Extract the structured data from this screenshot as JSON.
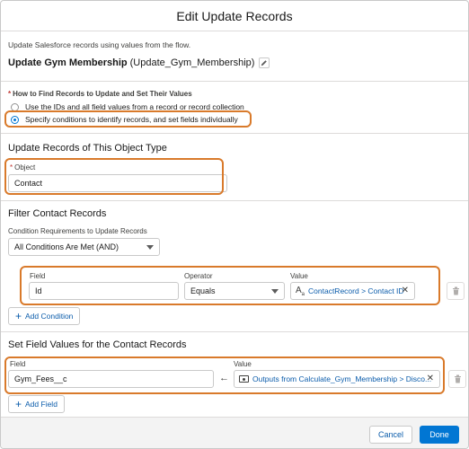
{
  "header": {
    "title": "Edit Update Records"
  },
  "intro": "Update Salesforce records using values from the flow.",
  "element": {
    "label": "Update Gym Membership",
    "api_name": "(Update_Gym_Membership)"
  },
  "how_to_find": {
    "label": "How to Find Records to Update and Set Their Values",
    "options": [
      {
        "label": "Use the IDs and all field values from a record or record collection",
        "selected": false
      },
      {
        "label": "Specify conditions to identify records, and set fields individually",
        "selected": true
      }
    ]
  },
  "object_section": {
    "title": "Update Records of This Object Type",
    "object_label": "Object",
    "object_value": "Contact"
  },
  "filter_section": {
    "title": "Filter Contact Records",
    "requirement_label": "Condition Requirements to Update Records",
    "requirement_value": "All Conditions Are Met (AND)",
    "columns": {
      "field": "Field",
      "operator": "Operator",
      "value": "Value"
    },
    "condition": {
      "field": "Id",
      "operator": "Equals",
      "value": "ContactRecord > Contact ID"
    },
    "add_condition": "Add Condition"
  },
  "set_section": {
    "title": "Set Field Values for the Contact Records",
    "columns": {
      "field": "Field",
      "value": "Value"
    },
    "row": {
      "field": "Gym_Fees__c",
      "value": "Outputs from Calculate_Gym_Membership > Disco..."
    },
    "add_field": "Add Field"
  },
  "footer": {
    "cancel": "Cancel",
    "done": "Done"
  },
  "icons": {
    "edit": "pencil-icon",
    "close": "close-icon",
    "trash": "trash-icon",
    "text_type": "text-resource-icon",
    "output": "output-resource-icon",
    "arrow": "left-arrow-icon"
  },
  "colors": {
    "accent": "#0176d3",
    "link": "#0b5cab",
    "highlight": "#d97a2b",
    "required": "#c23934"
  }
}
